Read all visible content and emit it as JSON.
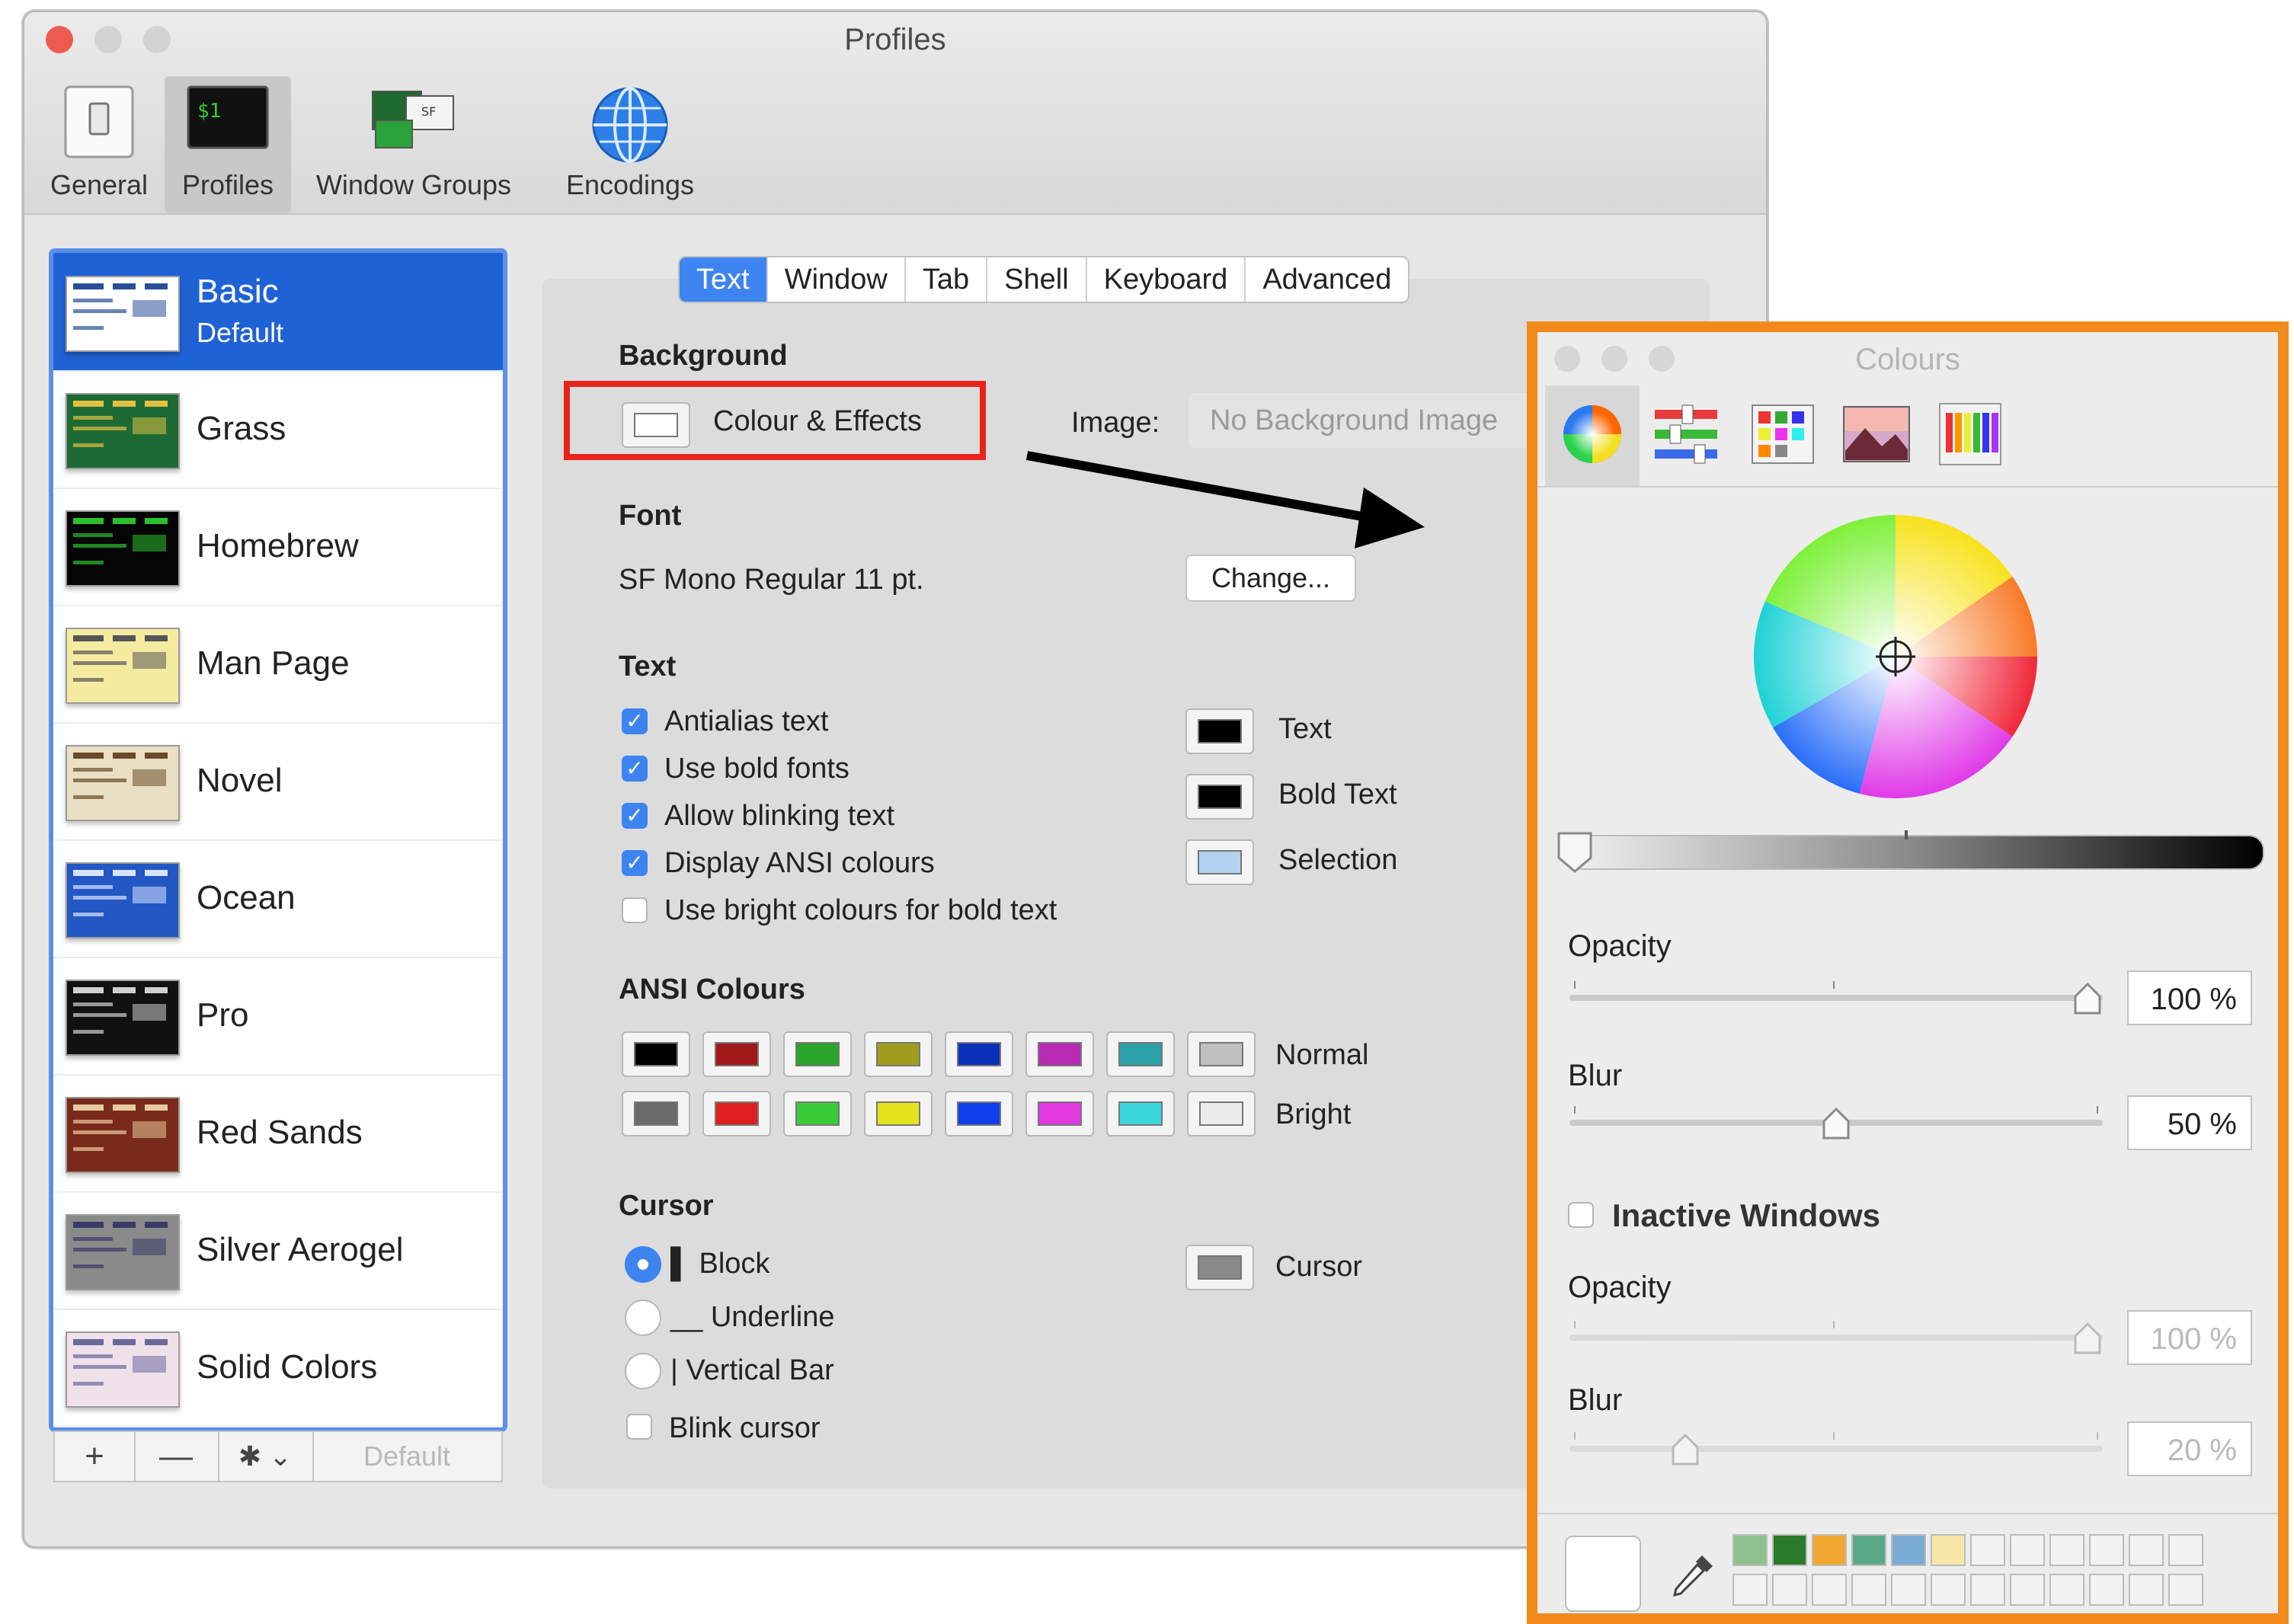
{
  "window": {
    "title": "Profiles",
    "toolbar": [
      {
        "id": "general",
        "label": "General",
        "icon": "switch-icon"
      },
      {
        "id": "profiles",
        "label": "Profiles",
        "icon": "terminal-icon",
        "selected": true
      },
      {
        "id": "window_groups",
        "label": "Window Groups",
        "icon": "window-groups-icon"
      },
      {
        "id": "encodings",
        "label": "Encodings",
        "icon": "globe-icon"
      }
    ]
  },
  "profiles": [
    {
      "name": "Basic",
      "sub": "Default",
      "selected": true,
      "bg": "#ffffff",
      "fg": "#2a4e9a"
    },
    {
      "name": "Grass",
      "bg": "#1d6a35",
      "fg": "#e0c040"
    },
    {
      "name": "Homebrew",
      "bg": "#050505",
      "fg": "#2dc02d"
    },
    {
      "name": "Man Page",
      "bg": "#f5eba0",
      "fg": "#555555"
    },
    {
      "name": "Novel",
      "bg": "#e8dfc4",
      "fg": "#6b4a2a"
    },
    {
      "name": "Ocean",
      "bg": "#2357c4",
      "fg": "#d8e4ff"
    },
    {
      "name": "Pro",
      "bg": "#111111",
      "fg": "#d0d0d0"
    },
    {
      "name": "Red Sands",
      "bg": "#7a2a1a",
      "fg": "#e8c8a0"
    },
    {
      "name": "Silver Aerogel",
      "bg": "#8a8a8a",
      "fg": "#3a3a6a"
    },
    {
      "name": "Solid Colors",
      "bg": "#f0e0ea",
      "fg": "#6a6a9a"
    }
  ],
  "sidebar_footer": {
    "add": "+",
    "remove": "—",
    "gear": "✱ ⌄",
    "default": "Default"
  },
  "tabs": [
    "Text",
    "Window",
    "Tab",
    "Shell",
    "Keyboard",
    "Advanced"
  ],
  "background": {
    "heading": "Background",
    "colour_effects": "Colour & Effects",
    "image_label": "Image:",
    "image_value": "No Background Image"
  },
  "font": {
    "heading": "Font",
    "value": "SF Mono Regular 11 pt.",
    "change": "Change..."
  },
  "text": {
    "heading": "Text",
    "options": [
      {
        "label": "Antialias text",
        "checked": true
      },
      {
        "label": "Use bold fonts",
        "checked": true
      },
      {
        "label": "Allow blinking text",
        "checked": true
      },
      {
        "label": "Display ANSI colours",
        "checked": true
      },
      {
        "label": "Use bright colours for bold text",
        "checked": false
      }
    ],
    "wells": [
      {
        "label": "Text",
        "color": "#000000"
      },
      {
        "label": "Bold Text",
        "color": "#000000"
      },
      {
        "label": "Selection",
        "color": "#b4d2f2"
      }
    ]
  },
  "ansi": {
    "heading": "ANSI Colours",
    "normal_label": "Normal",
    "bright_label": "Bright",
    "normal": [
      "#000000",
      "#a3191b",
      "#2aa52a",
      "#a09c1e",
      "#0a2fb8",
      "#b62ab4",
      "#2aa0a8",
      "#c0c0c0"
    ],
    "bright": [
      "#6a6a6a",
      "#e02020",
      "#38cd38",
      "#e6e21e",
      "#1040ee",
      "#e23ae0",
      "#3ad6dc",
      "#ececec"
    ]
  },
  "cursor": {
    "heading": "Cursor",
    "options": [
      {
        "label": "▌ Block",
        "selected": true
      },
      {
        "label": "__ Underline",
        "selected": false
      },
      {
        "label": "| Vertical Bar",
        "selected": false
      }
    ],
    "blink": "Blink cursor",
    "well_label": "Cursor",
    "well_color": "#8a8a8a"
  },
  "colours_panel": {
    "title": "Colours",
    "modes": [
      "colour-wheel-icon",
      "sliders-icon",
      "palettes-icon",
      "image-palette-icon",
      "pencils-icon"
    ],
    "opacity_label": "Opacity",
    "opacity_value": "100 %",
    "opacity_level": 1.0,
    "blur_label": "Blur",
    "blur_value": "50 %",
    "blur_level": 0.5,
    "inactive_label": "Inactive Windows",
    "inactive_opacity_label": "Opacity",
    "inactive_opacity_value": "100 %",
    "inactive_opacity_level": 1.0,
    "inactive_blur_label": "Blur",
    "inactive_blur_value": "20 %",
    "inactive_blur_level": 0.2,
    "swatches": [
      "#8fc08f",
      "#2a7a2a",
      "#f0a830",
      "#5aaa8a",
      "#7aaad6",
      "#f6e6a8"
    ]
  },
  "accent": "#3d84f0",
  "highlight_color": "#e8241a",
  "panel_border_color": "#f28a1b"
}
